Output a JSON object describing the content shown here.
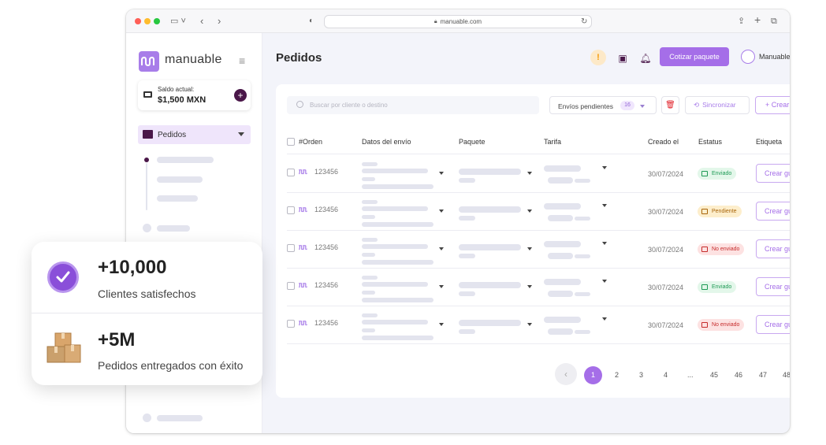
{
  "browser": {
    "url": "manuable.com"
  },
  "sidebar": {
    "logo_text": "manuable",
    "saldo_label": "Saldo actual:",
    "saldo_amount": "$1,500 MXN",
    "nav_pedidos": "Pedidos"
  },
  "header": {
    "title": "Pedidos",
    "cotizar_label": "Cotizar paquete",
    "user_name": "Manuable"
  },
  "toolbar": {
    "search_placeholder": "Buscar por cliente o destino",
    "filter_label": "Envíos pendientes",
    "filter_count": "16",
    "sync_label": "Sincronizar",
    "create_label": "+ Crear"
  },
  "table": {
    "headers": [
      "#Orden",
      "Datos del envío",
      "Paquete",
      "Tarifa",
      "Creado el",
      "Estatus",
      "Etiqueta"
    ],
    "rows": [
      {
        "order": "123456",
        "date": "30/07/2024",
        "status": "Enviado",
        "action": "Crear guía"
      },
      {
        "order": "123456",
        "date": "30/07/2024",
        "status": "Pendiente",
        "action": "Crear guía"
      },
      {
        "order": "123456",
        "date": "30/07/2024",
        "status": "No enviado",
        "action": "Crear guía"
      },
      {
        "order": "123456",
        "date": "30/07/2024",
        "status": "Enviado",
        "action": "Crear guía"
      },
      {
        "order": "123456",
        "date": "30/07/2024",
        "status": "No enviado",
        "action": "Crear guía"
      }
    ]
  },
  "pagination": {
    "prev": "‹",
    "current": "1",
    "pages": [
      "2",
      "3",
      "4",
      "...",
      "45",
      "46",
      "47",
      "48"
    ]
  },
  "stats": {
    "clients_value": "+10,000",
    "clients_label": "Clientes satisfechos",
    "orders_value": "+5M",
    "orders_label": "Pedidos entregados con éxito"
  }
}
